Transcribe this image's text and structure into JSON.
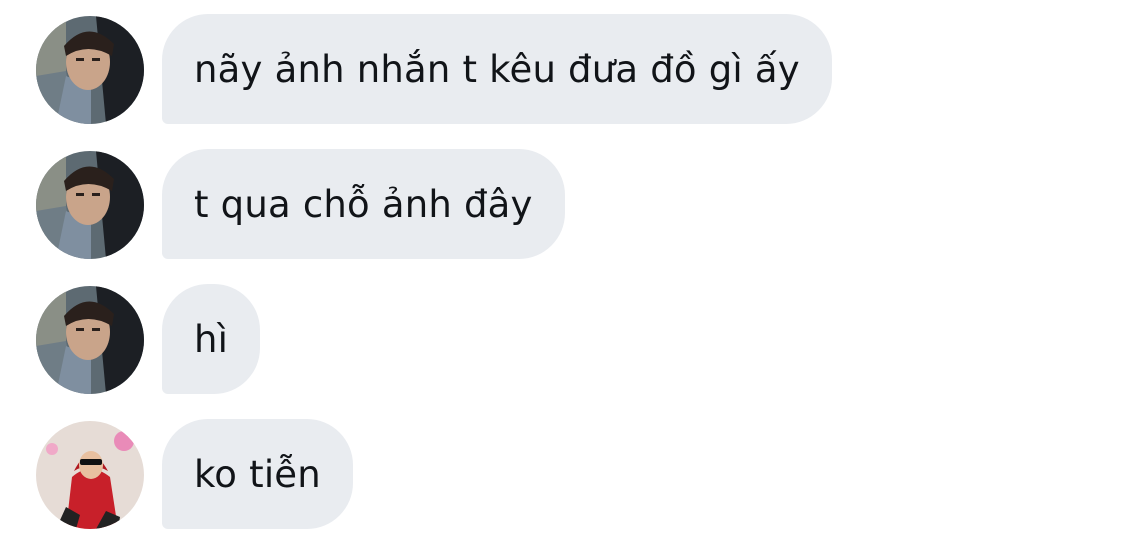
{
  "messages": [
    {
      "sender": "friend",
      "avatar": "friend-avatar",
      "text": "nãy ảnh nhắn t kêu đưa đồ gì ấy"
    },
    {
      "sender": "friend",
      "avatar": "friend-avatar",
      "text": "t qua chỗ ảnh đây"
    },
    {
      "sender": "friend",
      "avatar": "friend-avatar",
      "text": "hì"
    },
    {
      "sender": "other",
      "avatar": "red-hoodie-avatar",
      "text": "ko tiễn"
    }
  ],
  "colors": {
    "bubble_background": "#e9ecf0",
    "text": "#111418",
    "page_background": "#ffffff"
  }
}
